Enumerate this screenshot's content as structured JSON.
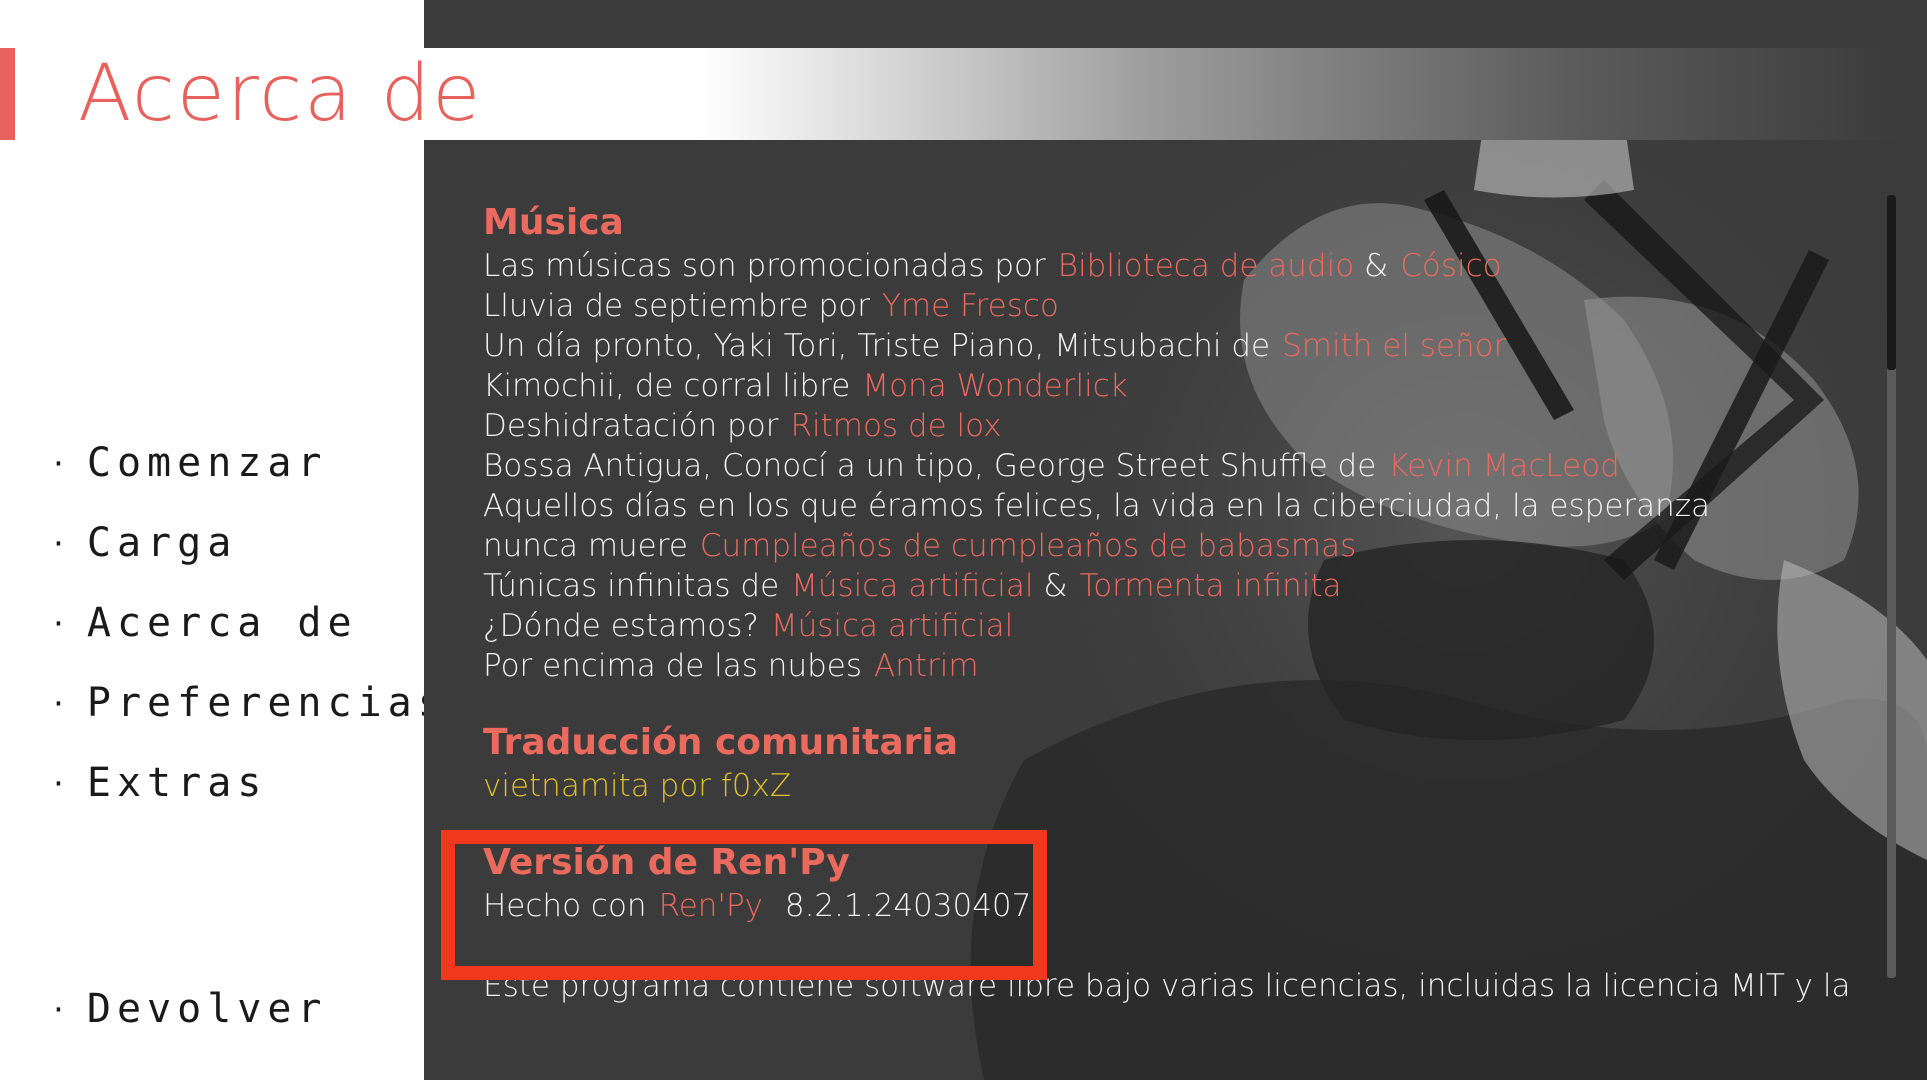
{
  "header": {
    "title": "Acerca de"
  },
  "nav": {
    "bullet": "·",
    "items": [
      "Comenzar",
      "Carga",
      "Acerca de",
      "Preferencias",
      "Extras"
    ],
    "return_label": "Devolver"
  },
  "music": {
    "title": "Música",
    "lines": [
      {
        "text": "Las músicas son promocionadas por",
        "links": [
          "Biblioteca de audio",
          "Cósico"
        ],
        "sep": "&"
      },
      {
        "text": "Lluvia de septiembre por",
        "links": [
          "Yme Fresco"
        ]
      },
      {
        "text": "Un día pronto, Yaki Tori, Triste Piano, Mitsubachi de",
        "links": [
          "Smith el señor"
        ]
      },
      {
        "text": "Kimochii, de corral libre",
        "links": [
          "Mona Wonderlick"
        ]
      },
      {
        "text": "Deshidratación por",
        "links": [
          "Ritmos de lox"
        ]
      },
      {
        "text": "Bossa Antigua, Conocí a un tipo, George Street Shuffle de",
        "links": [
          "Kevin MacLeod"
        ]
      },
      {
        "text": "Aquellos días en los que éramos felices, la vida en la ciberciudad, la esperanza nunca muere",
        "links": [
          "Cumpleaños de cumpleaños de babasmas"
        ]
      },
      {
        "text": "Túnicas infinitas de",
        "links": [
          "Música artificial",
          "Tormenta infinita"
        ],
        "sep": "&"
      },
      {
        "text": "¿Dónde estamos?",
        "links": [
          "Música artificial"
        ]
      },
      {
        "text": "Por encima de las nubes",
        "links": [
          "Antrim"
        ]
      }
    ]
  },
  "translation": {
    "title": "Traducción comunitaria",
    "credit": "vietnamita por f0xZ"
  },
  "renpy": {
    "title": "Versión de Ren'Py",
    "made_with": "Hecho con",
    "link": "Ren'Py",
    "version": "8.2.1.24030407",
    "period": "."
  },
  "license_text": "Este programa contiene software libre bajo varias licencias, incluidas la licencia MIT y la",
  "colors": {
    "accent": "#e8625d",
    "panel": "#3b3b3b",
    "credit_yellow": "#e1c12a",
    "highlight": "#f2381c"
  }
}
